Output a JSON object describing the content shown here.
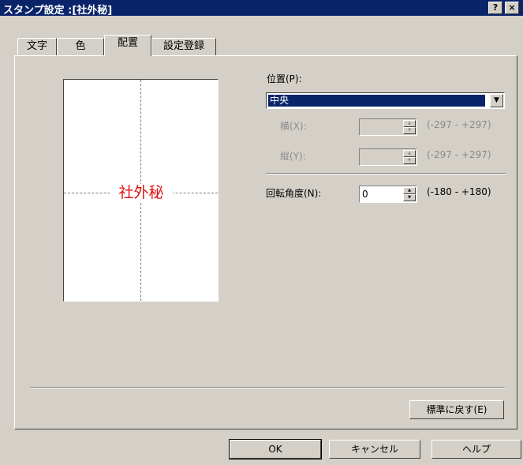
{
  "window": {
    "title": "スタンプ設定 :[社外秘]",
    "help_glyph": "?",
    "close_glyph": "×"
  },
  "tabs": [
    {
      "label": "文字"
    },
    {
      "label": "色"
    },
    {
      "label": "配置"
    },
    {
      "label": "設定登録"
    }
  ],
  "preview": {
    "stamp_text": "社外秘",
    "stamp_color": "#e01010"
  },
  "position": {
    "label": "位置(P):",
    "selected": "中央",
    "dropdown_glyph": "▼"
  },
  "horizontal": {
    "label": "横(X):",
    "value": "",
    "range": "(-297 - +297)"
  },
  "vertical": {
    "label": "縦(Y):",
    "value": "",
    "range": "(-297 - +297)"
  },
  "rotation": {
    "label": "回転角度(N):",
    "value": "0",
    "range": "(-180 - +180)"
  },
  "spin_glyphs": {
    "up": "▲",
    "down": "▼"
  },
  "buttons": {
    "reset": "標準に戻す(E)",
    "ok": "OK",
    "cancel": "キャンセル",
    "help": "ヘルプ"
  },
  "colors": {
    "title_bar": "#0a246a",
    "dialog_bg": "#d4d0c8",
    "selection": "#0a246a"
  }
}
